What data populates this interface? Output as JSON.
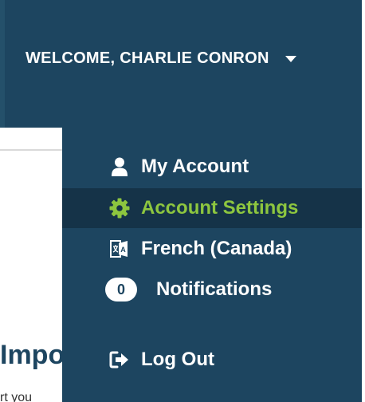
{
  "header": {
    "welcome_text": "WELCOME, CHARLIE CONRON"
  },
  "background_page": {
    "heading_fragment": "Impo",
    "text_fragment": "rt you"
  },
  "menu": {
    "items": [
      {
        "label": "My Account",
        "icon": "user-icon"
      },
      {
        "label": "Account Settings",
        "icon": "gear-icon",
        "active": true
      },
      {
        "label": "French (Canada)",
        "icon": "language-icon"
      },
      {
        "label": "Notifications",
        "badge": "0"
      },
      {
        "label": "Log Out",
        "icon": "logout-icon"
      }
    ]
  },
  "colors": {
    "navy": "#1d4560",
    "active_bg": "#153348",
    "accent_green": "#8dc63f"
  }
}
